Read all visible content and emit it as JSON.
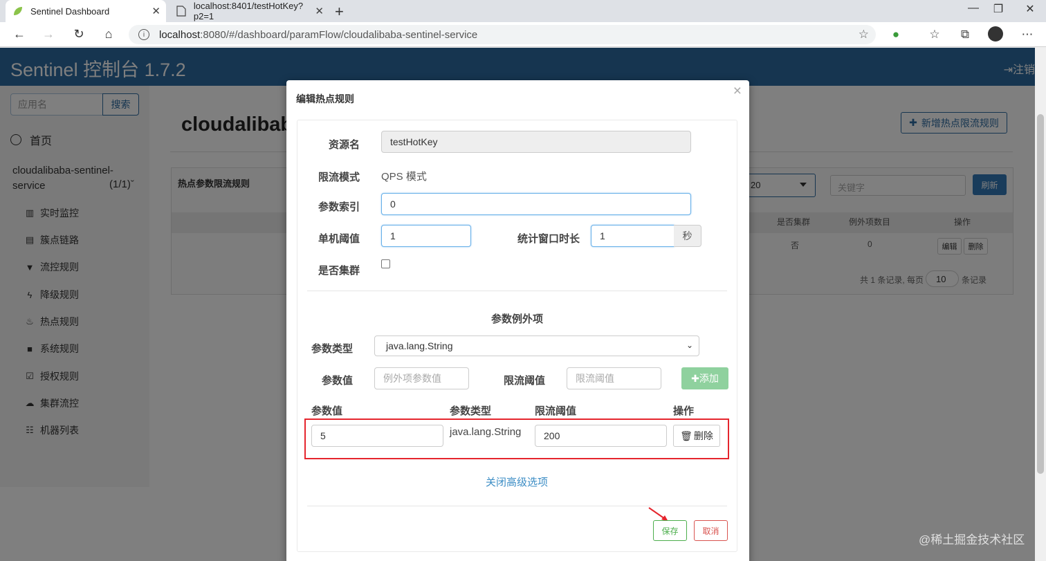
{
  "browser": {
    "tabs": [
      {
        "title": "Sentinel Dashboard",
        "active": true
      },
      {
        "title": "localhost:8401/testHotKey?p2=1",
        "active": false
      }
    ],
    "url_host": "localhost",
    "url_rest": ":8080/#/dashboard/paramFlow/cloudalibaba-sentinel-service",
    "icons": {
      "back": "back-arrow-icon",
      "forward": "forward-arrow-icon",
      "reload": "reload-icon",
      "home": "home-icon",
      "star": "star-icon",
      "favorites": "favorites-icon",
      "collections": "collections-icon",
      "more": "more-icon"
    }
  },
  "app": {
    "brand": "Sentinel 控制台 1.7.2",
    "logout": "注销",
    "header_color": "#2c6aa0"
  },
  "sidebar": {
    "search_placeholder": "应用名",
    "search_button": "搜索",
    "home": "首页",
    "app_name": "cloudalibaba-sentinel-service",
    "app_count": "(1/1)",
    "items": [
      {
        "label": "实时监控",
        "icon": "bar-chart-icon"
      },
      {
        "label": "簇点链路",
        "icon": "list-icon"
      },
      {
        "label": "流控规则",
        "icon": "filter-icon"
      },
      {
        "label": "降级规则",
        "icon": "flash-icon"
      },
      {
        "label": "热点规则",
        "icon": "fire-icon"
      },
      {
        "label": "系统规则",
        "icon": "lock-icon"
      },
      {
        "label": "授权规则",
        "icon": "check-icon"
      },
      {
        "label": "集群流控",
        "icon": "cloud-icon"
      },
      {
        "label": "机器列表",
        "icon": "th-list-icon"
      }
    ]
  },
  "main": {
    "title": "cloudalibab",
    "add_rule_button": "新增热点限流规则",
    "panel_title": "热点参数限流规则",
    "machine_select": "20",
    "keyword_placeholder": "关键字",
    "refresh": "刷新",
    "columns": {
      "cluster": "是否集群",
      "exceptions": "例外项数目",
      "ops": "操作"
    },
    "row": {
      "cluster": "否",
      "exceptions": "0",
      "edit": "编辑",
      "delete": "删除"
    },
    "pager_prefix": "共 1 条记录, 每页",
    "page_size": "10",
    "pager_suffix": "条记录"
  },
  "modal": {
    "title": "编辑热点规则",
    "close": "×",
    "resource_label": "资源名",
    "resource_value": "testHotKey",
    "mode_label": "限流模式",
    "mode_value": "QPS 模式",
    "param_index_label": "参数索引",
    "param_index_value": "0",
    "threshold_label": "单机阈值",
    "threshold_value": "1",
    "window_label": "统计窗口时长",
    "window_value": "1",
    "window_unit": "秒",
    "cluster_label": "是否集群",
    "exceptions_title": "参数例外项",
    "param_type_label": "参数类型",
    "param_type_value": "java.lang.String",
    "param_value_label": "参数值",
    "param_value_placeholder": "例外项参数值",
    "limit_label": "限流阈值",
    "limit_placeholder": "限流阈值",
    "add_button": "添加",
    "table_headers": {
      "value": "参数值",
      "type": "参数类型",
      "limit": "限流阈值",
      "ops": "操作"
    },
    "exception_row": {
      "value": "5",
      "type": "java.lang.String",
      "limit": "200",
      "delete": "删除"
    },
    "toggle_advanced": "关闭高级选项",
    "save": "保存",
    "cancel": "取消"
  },
  "watermark": "@稀土掘金技术社区"
}
